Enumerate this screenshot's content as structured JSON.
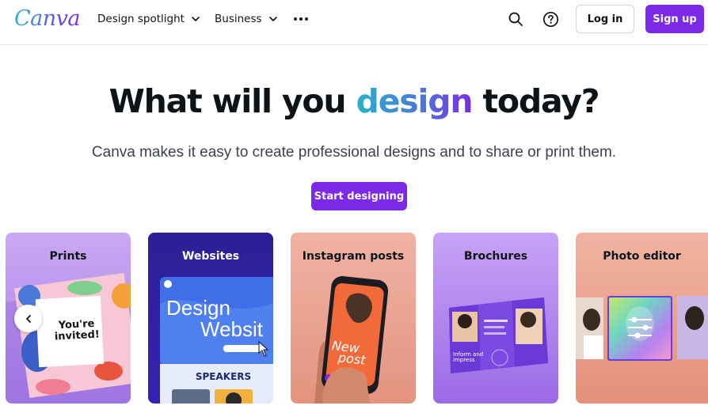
{
  "nav": {
    "logo": "Canva",
    "links": [
      {
        "label": "Design spotlight"
      },
      {
        "label": "Business"
      }
    ],
    "login_label": "Log in",
    "signup_label": "Sign up"
  },
  "hero": {
    "title_before": "What will you",
    "title_highlight": "design",
    "title_after": "today?",
    "subtitle": "Canva makes it easy to create professional designs and to share or print them.",
    "cta_label": "Start designing"
  },
  "cards": [
    {
      "title": "Prints",
      "invite_text": "You're invited!"
    },
    {
      "title": "Websites",
      "hero_text_1": "Design",
      "hero_text_2": "Websit",
      "speakers": "SPEAKERS"
    },
    {
      "title": "Instagram posts",
      "post_text_1": "New",
      "post_text_2": "post"
    },
    {
      "title": "Brochures",
      "brochure_text": "Inform and impress"
    },
    {
      "title": "Photo editor"
    }
  ],
  "colors": {
    "brand_purple": "#7d2ae8",
    "text": "#0e1318"
  },
  "icons": {
    "search": "search-icon",
    "help": "help-icon",
    "more": "more-icon",
    "chevron": "chevron-down-icon",
    "prev": "chevron-left-icon"
  }
}
